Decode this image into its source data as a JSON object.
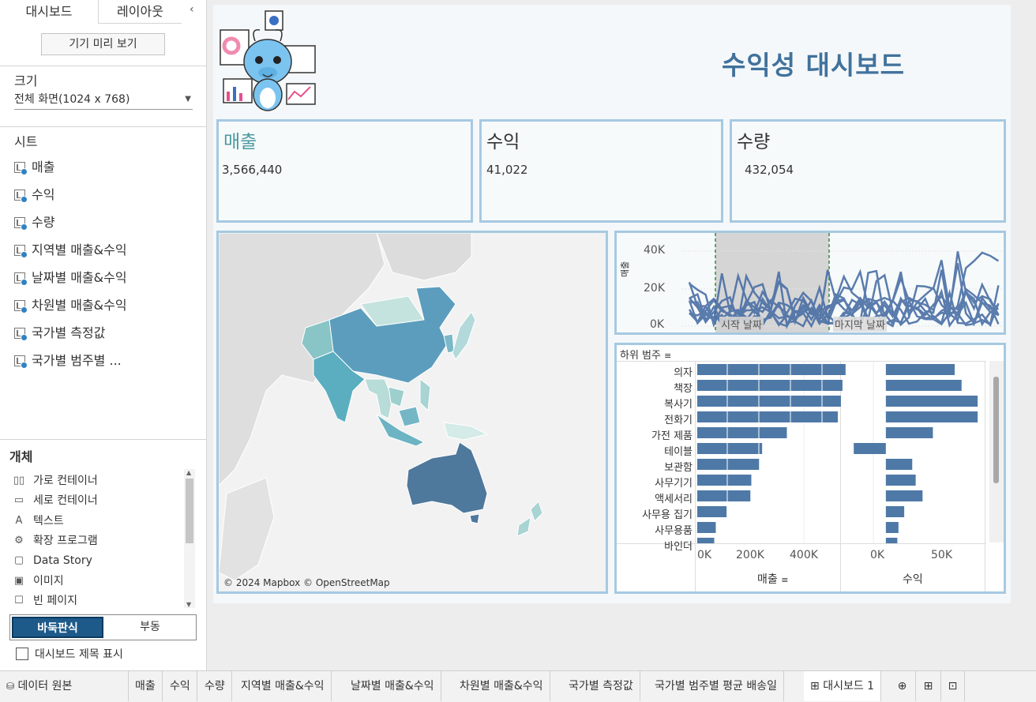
{
  "left_panel": {
    "tabs": {
      "dashboard": "대시보드",
      "layout": "레이아웃",
      "collapse": "‹"
    },
    "device_preview": "기기 미리 보기",
    "size": {
      "title": "크기",
      "value": "전체 화면(1024 x 768)"
    },
    "sheets": {
      "title": "시트",
      "items": [
        "매출",
        "수익",
        "수량",
        "지역별 매출&수익",
        "날짜별 매출&수익",
        "차원별 매출&수익",
        "국가별 측정값",
        "국가별 범주별 ..."
      ]
    },
    "objects": {
      "title": "개체",
      "items": [
        "가로 컨테이너",
        "세로 컨테이너",
        "텍스트",
        "확장 프로그램",
        "Data Story",
        "이미지",
        "빈 페이지"
      ],
      "icons": [
        "horizontal-container-icon",
        "vertical-container-icon",
        "text-icon",
        "extension-icon",
        "book-icon",
        "image-icon",
        "blank-page-icon"
      ]
    },
    "layout_mode": {
      "tiled": "바둑판식",
      "floating": "부동"
    },
    "show_title": "대시보드 제목 표시"
  },
  "dashboard": {
    "title": "수익성 대시보드",
    "kpis": [
      {
        "title": "매출",
        "value": "3,566,440",
        "color": "#4a9aa0"
      },
      {
        "title": "수익",
        "value": "41,022",
        "color": "#333333"
      },
      {
        "title": "수량",
        "value": "432,054",
        "color": "#333333"
      }
    ],
    "map": {
      "credit": "© 2024 Mapbox © OpenStreetMap"
    },
    "line_chart": {
      "y_ticks": [
        "40K",
        "20K",
        "0K"
      ],
      "ylabel": "매출",
      "start_label": "시작 날짜",
      "end_label": "마지막 날짜"
    },
    "bar_chart": {
      "header": "하위 범주",
      "sales_axis": {
        "title": "매출",
        "ticks": [
          "0K",
          "200K",
          "400K"
        ]
      },
      "profit_axis": {
        "title": "수익",
        "ticks": [
          "0K",
          "50K"
        ]
      }
    }
  },
  "bottom_tabs": [
    "데이터 원본",
    "매출",
    "수익",
    "수량",
    "지역별 매출&수익",
    "날짜별 매출&수익",
    "차원별 매출&수익",
    "국가별 측정값",
    "국가별 범주별 평균 배송일",
    "대시보드 1"
  ],
  "chart_data": {
    "type": "bar",
    "categories": [
      "의자",
      "책장",
      "복사기",
      "전화기",
      "가전 제품",
      "테이블",
      "보관함",
      "사무기기",
      "액세서리",
      "사무용 집기",
      "사무용품",
      "바인더"
    ],
    "series": [
      {
        "name": "매출",
        "values": [
          480000,
          470000,
          465000,
          455000,
          290000,
          210000,
          200000,
          175000,
          172000,
          95000,
          60000,
          55000
        ]
      },
      {
        "name": "수익",
        "values": [
          60000,
          66000,
          80000,
          80000,
          41000,
          -28000,
          23000,
          26000,
          32000,
          16000,
          11000,
          10000
        ]
      }
    ],
    "xlim_sales": [
      0,
      460000
    ],
    "xlim_profit": [
      -35000,
      82000
    ]
  },
  "colors": {
    "accent": "#41729c",
    "bar": "#4e79a7",
    "border": "#a6c9e2",
    "tiled_button": "#1d5a8a"
  }
}
